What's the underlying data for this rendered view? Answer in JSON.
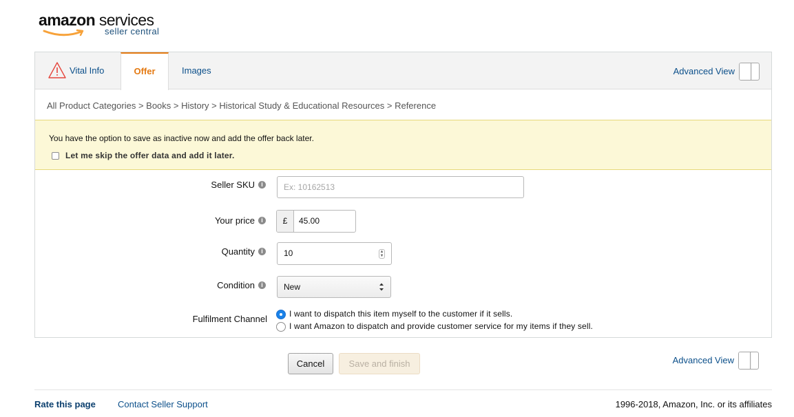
{
  "logo": {
    "word_amazon": "amazon",
    "word_services": " services",
    "subtitle": "seller central",
    "smile_color": "#f7a23a"
  },
  "tabs": [
    {
      "label": "Vital Info",
      "icon": "warning-triangle-icon",
      "icon_color": "#e5453c"
    },
    {
      "label": "Offer",
      "active": true,
      "accent_color": "#e47911"
    },
    {
      "label": "Images"
    }
  ],
  "advanced_view": {
    "label": "Advanced View"
  },
  "breadcrumb": "All Product Categories > Books > History > Historical Study & Educational Resources > Reference",
  "notice": {
    "text": "You have the option to save as inactive now and add the offer back later.",
    "checkbox_label": "Let me skip the offer data and add it later.",
    "background": "#fcf8d7"
  },
  "form": {
    "seller_sku": {
      "label": "Seller SKU",
      "placeholder": "Ex: 10162513",
      "value": ""
    },
    "price": {
      "label": "Your price",
      "currency": "£",
      "value": "45.00"
    },
    "quantity": {
      "label": "Quantity",
      "value": "10"
    },
    "condition": {
      "label": "Condition",
      "value": "New"
    },
    "fulfilment": {
      "label": "Fulfilment Channel",
      "options": [
        {
          "label": "I want to dispatch this item myself to the customer if it sells.",
          "selected": true
        },
        {
          "label": "I want Amazon to dispatch and provide customer service for my items if they sell.",
          "selected": false
        }
      ]
    },
    "info_icon_glyph": "i"
  },
  "actions": {
    "cancel": "Cancel",
    "save": "Save and finish"
  },
  "footer": {
    "rate": "Rate this page",
    "contact": "Contact Seller Support",
    "copyright": "1996-2018, Amazon, Inc. or its affiliates"
  }
}
